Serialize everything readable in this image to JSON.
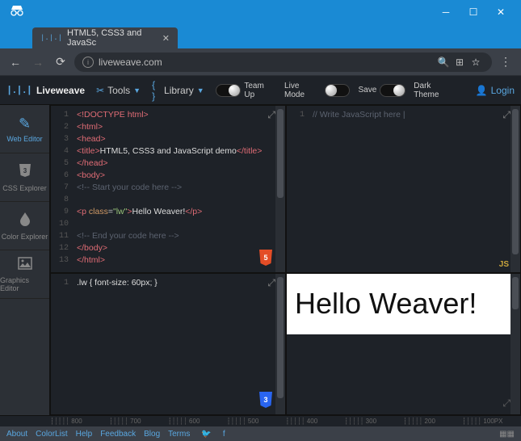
{
  "browser": {
    "tab_title": "HTML5, CSS3 and JavaSc",
    "url": "liveweave.com"
  },
  "appbar": {
    "brand": "Liveweave",
    "tools": "Tools",
    "library": "Library",
    "teamup": "Team Up",
    "livemode": "Live Mode",
    "save": "Save",
    "darktheme": "Dark Theme",
    "login": "Login"
  },
  "sidebar": {
    "items": [
      {
        "label": "Web Editor"
      },
      {
        "label": "CSS Explorer"
      },
      {
        "label": "Color Explorer"
      },
      {
        "label": "Graphics Editor"
      }
    ]
  },
  "html_code": {
    "lines": [
      {
        "n": "1",
        "h": "<span class='t-tag'>&lt;!DOCTYPE html&gt;</span>"
      },
      {
        "n": "2",
        "h": "<span class='t-tag'>&lt;html&gt;</span>"
      },
      {
        "n": "3",
        "h": "<span class='t-tag'>&lt;head&gt;</span>"
      },
      {
        "n": "4",
        "h": "<span class='t-tag'>&lt;title&gt;</span><span class='t-txt'>HTML5, CSS3 and JavaScript demo</span><span class='t-tag'>&lt;/title&gt;</span>"
      },
      {
        "n": "5",
        "h": "<span class='t-tag'>&lt;/head&gt;</span>"
      },
      {
        "n": "6",
        "h": "<span class='t-tag'>&lt;body&gt;</span>"
      },
      {
        "n": "7",
        "h": "<span class='t-com'>&lt;!-- Start your code here --&gt;</span>"
      },
      {
        "n": "8",
        "h": ""
      },
      {
        "n": "9",
        "h": "<span class='t-tag'>&lt;p</span> <span class='t-attr'>class</span>=<span class='t-str'>\"lw\"</span><span class='t-tag'>&gt;</span><span class='t-txt'>Hello Weaver!</span><span class='t-tag'>&lt;/p&gt;</span>"
      },
      {
        "n": "10",
        "h": ""
      },
      {
        "n": "11",
        "h": "<span class='t-com'>&lt;!-- End your code here --&gt;</span>"
      },
      {
        "n": "12",
        "h": "<span class='t-tag'>&lt;/body&gt;</span>"
      },
      {
        "n": "13",
        "h": "<span class='t-tag'>&lt;/html&gt;</span>"
      }
    ]
  },
  "css_code": {
    "lines": [
      {
        "n": "1",
        "h": "<span class='t-txt'>.lw { font-size: 60px; }</span>"
      }
    ]
  },
  "js_code": {
    "lines": [
      {
        "n": "1",
        "h": "<span class='t-com'>// Write JavaScript here |</span>"
      }
    ]
  },
  "preview_text": "Hello Weaver!",
  "ruler": [
    "800",
    "700",
    "600",
    "500",
    "400",
    "300",
    "200",
    "100PX"
  ],
  "footer": {
    "links": [
      "About",
      "ColorList",
      "Help",
      "Feedback",
      "Blog",
      "Terms"
    ]
  }
}
